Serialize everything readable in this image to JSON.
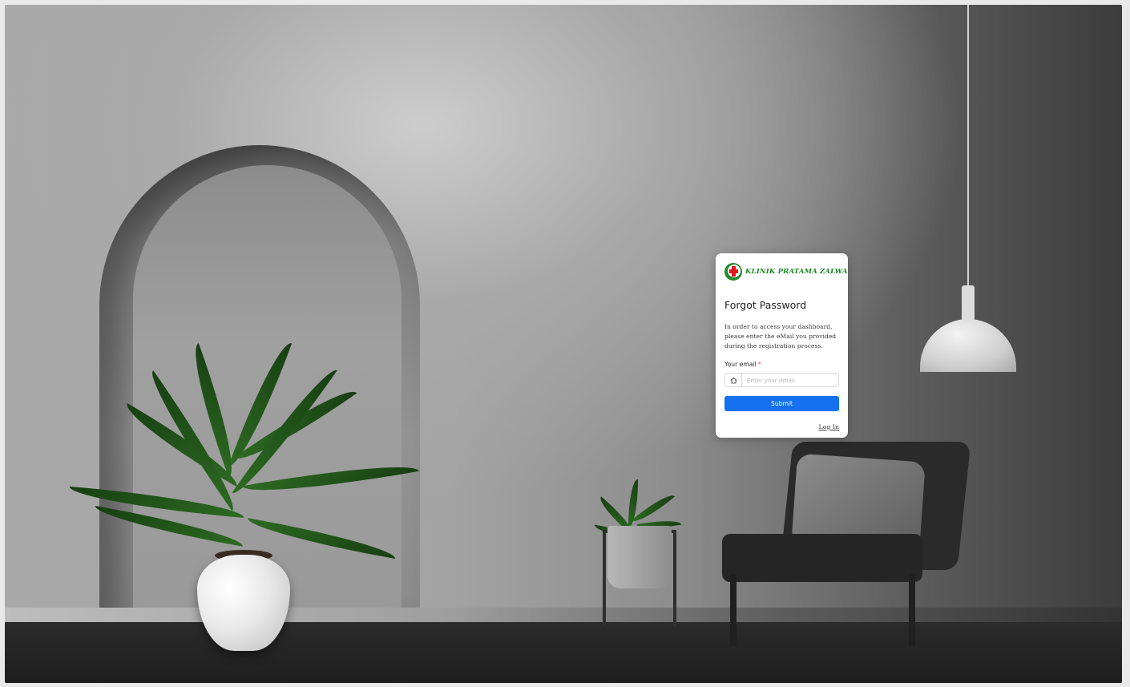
{
  "brand": {
    "name": "KLINIK PRATAMA ZALWA"
  },
  "form": {
    "title": "Forgot Password",
    "description": "In order to access your dashboard, please enter the eMail you provided during the registration process.",
    "email_label": "Your email",
    "required_marker": "*",
    "email_placeholder": "Enter your email",
    "email_value": "",
    "submit_label": "Submit",
    "login_link": "Log In"
  },
  "icons": {
    "email_field_icon": "home-icon"
  },
  "colors": {
    "brand_green": "#1f8a2a",
    "brand_red": "#e3161b",
    "primary_button": "#1671f0",
    "required": "#e23b3b"
  }
}
